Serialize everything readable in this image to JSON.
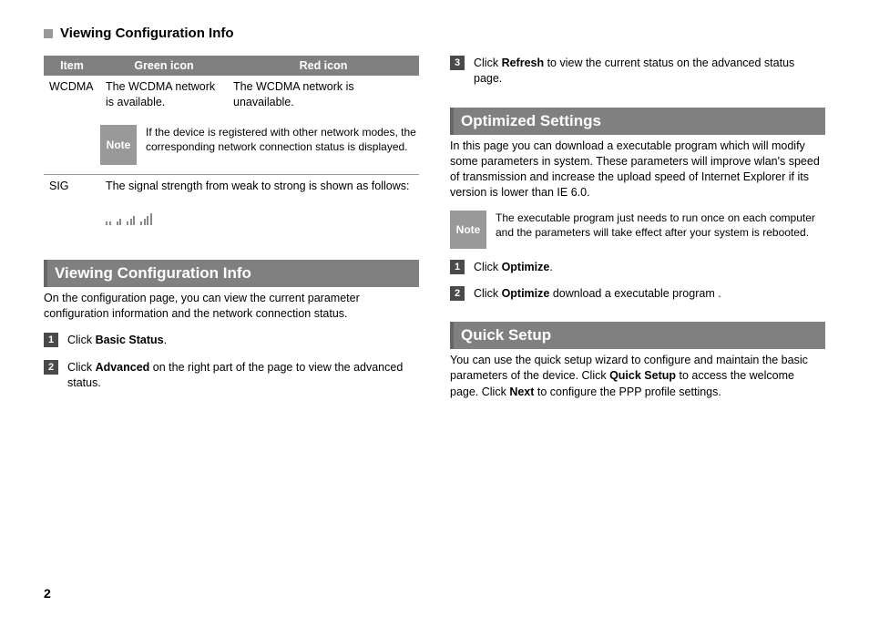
{
  "header": {
    "title": "Viewing Configuration Info"
  },
  "pageNumber": "2",
  "table": {
    "headers": [
      "Item",
      "Green icon",
      "Red icon"
    ],
    "rows": [
      {
        "item": "WCDMA",
        "green": "The WCDMA network is available.",
        "red": "The WCDMA network is unavailable."
      }
    ],
    "sigRow": {
      "item": "SIG",
      "desc": "The signal strength from weak to strong is shown as follows:"
    }
  },
  "note1": {
    "label": "Note",
    "text": "If the device is registered with other network modes, the corresponding network connection status is displayed."
  },
  "sec_vci": {
    "title": "Viewing Configuration Info",
    "intro": "On the configuration page, you can view the current parameter configuration information and the network connection status.",
    "step1_pre": "Click ",
    "step1_b": "Basic Status",
    "step1_post": ".",
    "step2_pre": "Click ",
    "step2_b": "Advanced",
    "step2_post": " on the right part of the page to view the advanced status.",
    "step3_pre": "Click ",
    "step3_b": "Refresh",
    "step3_post": " to view the current status on the advanced status page."
  },
  "sec_opt": {
    "title": "Optimized Settings",
    "intro": "In this page you can download a executable program which will modify some parameters in system. These parameters will improve wlan's speed of transmission and increase the upload speed of Internet Explorer if its version is lower than IE 6.0.",
    "note_label": "Note",
    "note_text": "The executable program just needs to run once on each computer and the parameters will take effect after your system is rebooted.",
    "step1_pre": "Click ",
    "step1_b": "Optimize",
    "step1_post": ".",
    "step2_pre": "Click ",
    "step2_b": "Optimize",
    "step2_post": " download a executable program ."
  },
  "sec_qs": {
    "title": "Quick Setup",
    "p_pre": "You can use the quick setup wizard to configure and maintain the basic parameters of the device. Click ",
    "p_b1": "Quick Setup",
    "p_mid": " to access the welcome page. Click ",
    "p_b2": "Next",
    "p_post": " to configure the PPP profile settings."
  },
  "nums": {
    "n1": "1",
    "n2": "2",
    "n3": "3"
  }
}
